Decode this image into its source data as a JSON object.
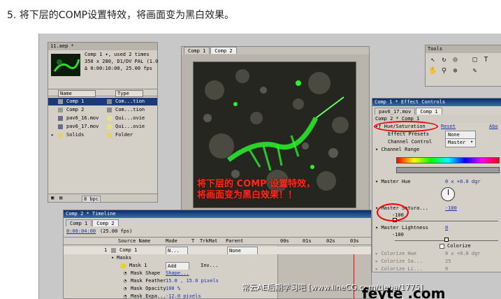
{
  "step_title": "5. 将下层的COMP设置特效，将画面变为黑白效果。",
  "project": {
    "title": "11.aep *",
    "info_lines": [
      "Comp 1 ▾, used 2 times",
      "350 x 280, D1/DV PAL (1.0",
      "Δ 0:00:10:00, 25.00 fps"
    ],
    "col_name": "Name",
    "col_type": "Type",
    "items": [
      {
        "name": "Comp 1",
        "type": "Com...tion",
        "color": "#8a8a8a"
      },
      {
        "name": "Comp 2",
        "type": "Com...tion",
        "color": "#8a8a8a"
      },
      {
        "name": "pav6_16.mov",
        "type": "Qui...ovie",
        "color": "#e6e08a"
      },
      {
        "name": "pav6_17.mov",
        "type": "Qui...ovie",
        "color": "#e6e08a"
      },
      {
        "name": "Solids",
        "type": "Folder",
        "color": "#e8d070"
      }
    ],
    "bpc": "8 bpc"
  },
  "viewer_tabs": [
    "Comp 1",
    "Comp 2"
  ],
  "overlay_text": [
    "将下层的 COMP 设置特效，",
    "将画面变为黑白效果！！"
  ],
  "tools_title": "Tools",
  "effect_controls": {
    "title": "Comp 1 * Effect Controls",
    "tabs": [
      "pav6_17.mov",
      "Comp 1"
    ],
    "layer_path": "Comp 2 * Comp 1",
    "effect_name": "Hue/Saturation",
    "reset": "Reset",
    "about": "Abo",
    "effect_presets": "Effect Presets",
    "presets_value": "None",
    "channel_control": "Channel Control",
    "channel_value": "Master",
    "channel_range": "Channel Range",
    "master_hue": "Master Hue",
    "hue_value": "0 x +0.0 dgr",
    "master_saturation": "Master Satura...",
    "sat_value": "-100",
    "sat_slider": "-100",
    "master_lightness": "Master Lightness",
    "light_value": "0",
    "light_slider": "-100",
    "colorize": "Colorize",
    "colorize_hue": "Colorize Hue",
    "colorize_hue_value": "0 x +0.0 dgr",
    "colorize_sat": "Colorize Sa...",
    "colorize_sat_value": "25",
    "colorize_light": "Colorize Li...",
    "colorize_light_value": "0"
  },
  "timeline": {
    "title": "Comp 2 * Timeline",
    "tabs": [
      "Comp 1",
      "Comp 2"
    ],
    "timecode": "0:00:04:00",
    "fps": "(25.00 fps)",
    "headers": [
      "Source Name",
      "Mode",
      "T",
      "TrkMat",
      "Parent"
    ],
    "ruler": [
      "00s",
      "01s",
      "02s",
      "03s"
    ],
    "layers": [
      {
        "num": "1",
        "name": "Comp 1",
        "mode": "N...",
        "parent": "None"
      },
      {
        "name": "Masks"
      },
      {
        "name": "Mask 1",
        "mode": "Add",
        "extra": "Inv..."
      },
      {
        "name": "Mask Shape",
        "value": "Shape..."
      },
      {
        "name": "Mask Feather",
        "value": "15.0 , 15.0 pixels"
      },
      {
        "name": "Mask Opacity",
        "value": "100 %"
      },
      {
        "name": "Mask Expa...",
        "value": "-12.0 pixels"
      }
    ]
  },
  "watermark": "常云AE后期学习吧 [www.lineCG.com/tieba/1775]",
  "logo": "feyte .com",
  "colors": {
    "accent_red": "#ff2020",
    "title_blue": "#1a3a7a",
    "ui_grey": "#d4d0c8"
  }
}
